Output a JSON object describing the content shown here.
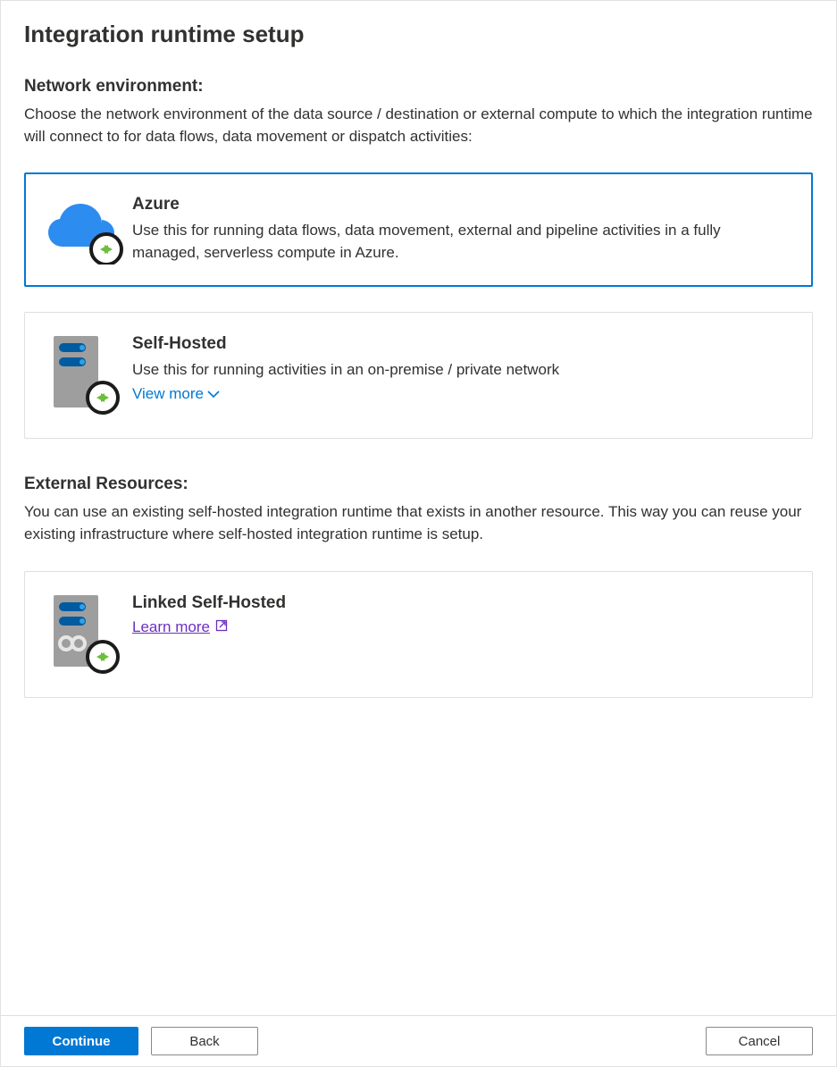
{
  "header": {
    "title": "Integration runtime setup"
  },
  "sections": {
    "network": {
      "title": "Network environment:",
      "desc": "Choose the network environment of the data source / destination or external compute to which the integration runtime will connect to for data flows, data movement or dispatch activities:"
    },
    "external": {
      "title": "External Resources:",
      "desc": "You can use an existing self-hosted integration runtime that exists in another resource. This way you can reuse your existing infrastructure where self-hosted integration runtime is setup."
    }
  },
  "options": {
    "azure": {
      "title": "Azure",
      "desc": "Use this for running data flows, data movement, external and pipeline activities in a fully managed, serverless compute in Azure.",
      "selected": true
    },
    "selfhosted": {
      "title": "Self-Hosted",
      "desc": "Use this for running activities in an on-premise / private network",
      "view_more": "View more"
    },
    "linked": {
      "title": "Linked Self-Hosted",
      "learn_more": "Learn more"
    }
  },
  "footer": {
    "continue": "Continue",
    "back": "Back",
    "cancel": "Cancel"
  },
  "colors": {
    "accent": "#0078d4",
    "link_visited": "#6b2fbf",
    "border": "#e1dfdd",
    "text": "#323130"
  }
}
